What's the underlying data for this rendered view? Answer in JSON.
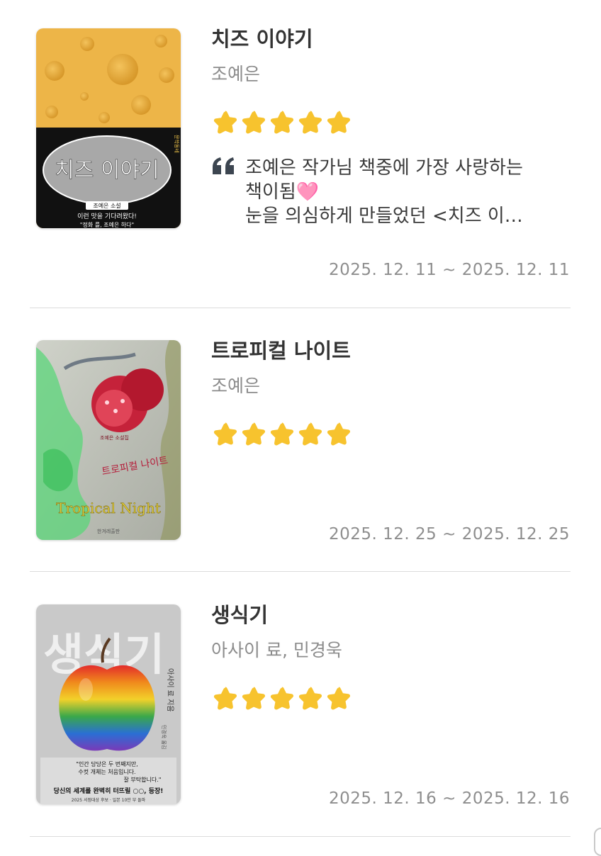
{
  "books": [
    {
      "title": "치즈 이야기",
      "author": "조예은",
      "rating": 5,
      "review_lines": [
        "조예은 작가님 책중에 가장 사랑하는",
        "책이됨🩷",
        "눈을 의심하게 만들었던 <치즈 이…"
      ],
      "dates": "2025. 12. 11 ~ 2025. 12. 11",
      "cover": {
        "title_text": "치즈 이야기",
        "author_text": "조예은 소설",
        "tagline": "이런 맛을 기다려왔다!",
        "tagline2": "\"정화 를, 조예은 하다\"",
        "publisher": "문학동네"
      }
    },
    {
      "title": "트로피컬 나이트",
      "author": "조예은",
      "rating": 5,
      "review_lines": [],
      "dates": "2025. 12. 25 ~ 2025. 12. 25",
      "cover": {
        "title_text": "트로피컬 나이트",
        "english_title": "Tropical Night",
        "author_text": "조예은 소설집",
        "publisher": "한겨레출판"
      }
    },
    {
      "title": "생식기",
      "author": "아사이 료, 민경욱",
      "rating": 5,
      "review_lines": [],
      "dates": "2025. 12. 16 ~ 2025. 12. 16",
      "cover": {
        "title_text": "생식기",
        "author_text": "아사이 료 지음",
        "translator_text": "민경욱 옮김",
        "blurb1": "\"인간 당당은 두 번째지만,",
        "blurb2": "수컷 개체는 처음입니다.",
        "blurb3": "잘 부탁합니다.\"",
        "banner": "당신의 세계를 완벽히 터뜨릴 ○○, 등장!",
        "footer": "2025 서점대상 후보 · 일본 10만 부 돌파"
      }
    }
  ],
  "colors": {
    "star": "#F7C32E",
    "title": "#333333",
    "muted": "#8C8C8C",
    "divider": "#DCDCDC",
    "quote_icon": "#3C4550"
  },
  "icons": {
    "star": "star-icon",
    "quote": "quote-icon"
  }
}
